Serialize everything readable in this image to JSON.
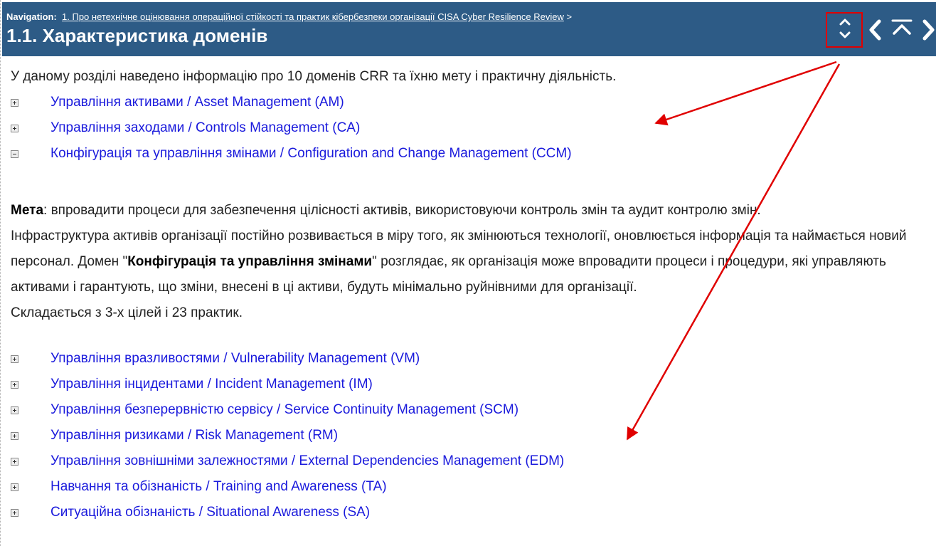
{
  "header": {
    "nav_label": "Navigation:",
    "breadcrumb": "1. Про нетехнічне оцінювання операційної стійкості та практик кібербезпеки організації CISA Cyber Resilience Review",
    "breadcrumb_separator": ">",
    "title": "1.1. Характеристика доменів"
  },
  "toolbar": {
    "buttons": [
      "expand-collapse-icon",
      "chevron-left-icon",
      "go-top-icon",
      "chevron-right-icon"
    ]
  },
  "content": {
    "intro": "У даному розділі наведено інформацію  про 10 доменів CRR та їхню мету і практичну діяльність.",
    "domains_before": [
      {
        "label": "Управління активами / Asset Management (AM)",
        "state": "collapsed"
      },
      {
        "label": "Управління заходами / Controls Management (CA)",
        "state": "collapsed"
      },
      {
        "label": "Конфігурація та управління змінами / Configuration and Change Management (CCM)",
        "state": "expanded"
      }
    ],
    "goal": {
      "label": "Мета",
      "text": ": впровадити процеси для забезпечення цілісності активів, використовуючи контроль змін та аудит контролю змін.",
      "p2_a": "Інфраструктура активів організації постійно розвивається в міру того, як змінюються технології, оновлюється інформація та наймається новий персонал. Домен \"",
      "p2_bold": "Конфігурація та управління змінами",
      "p2_b": "\" розглядає, як організація може впровадити процеси і процедури, які управляють активами і гарантують, що зміни, внесені в ці активи, будуть мінімально руйнівними для організації.",
      "p3": "Складається з 3-х цілей і 23 практик."
    },
    "domains_after": [
      {
        "label": "Управління вразливостями /  Vulnerability Management (VM)",
        "state": "collapsed"
      },
      {
        "label": "Управління інцидентами / Incident Management (IM)",
        "state": "collapsed"
      },
      {
        "label": "Управління безперервністю сервісу / Service Continuity Management (SCM)",
        "state": "collapsed"
      },
      {
        "label": "Управління ризиками / Risk Management (RM)",
        "state": "collapsed"
      },
      {
        "label": "Управління зовнішніми залежностями /  External Dependencies Management (EDM)",
        "state": "collapsed"
      },
      {
        "label": "Навчання та обізнаність / Training and Awareness (TA)",
        "state": "collapsed"
      },
      {
        "label": "Ситуаційна обізнаність / Situational Awareness (SA)",
        "state": "collapsed"
      }
    ]
  },
  "colors": {
    "header_bg": "#2d5b86",
    "link": "#1a1adc",
    "annotation": "#e00000"
  }
}
